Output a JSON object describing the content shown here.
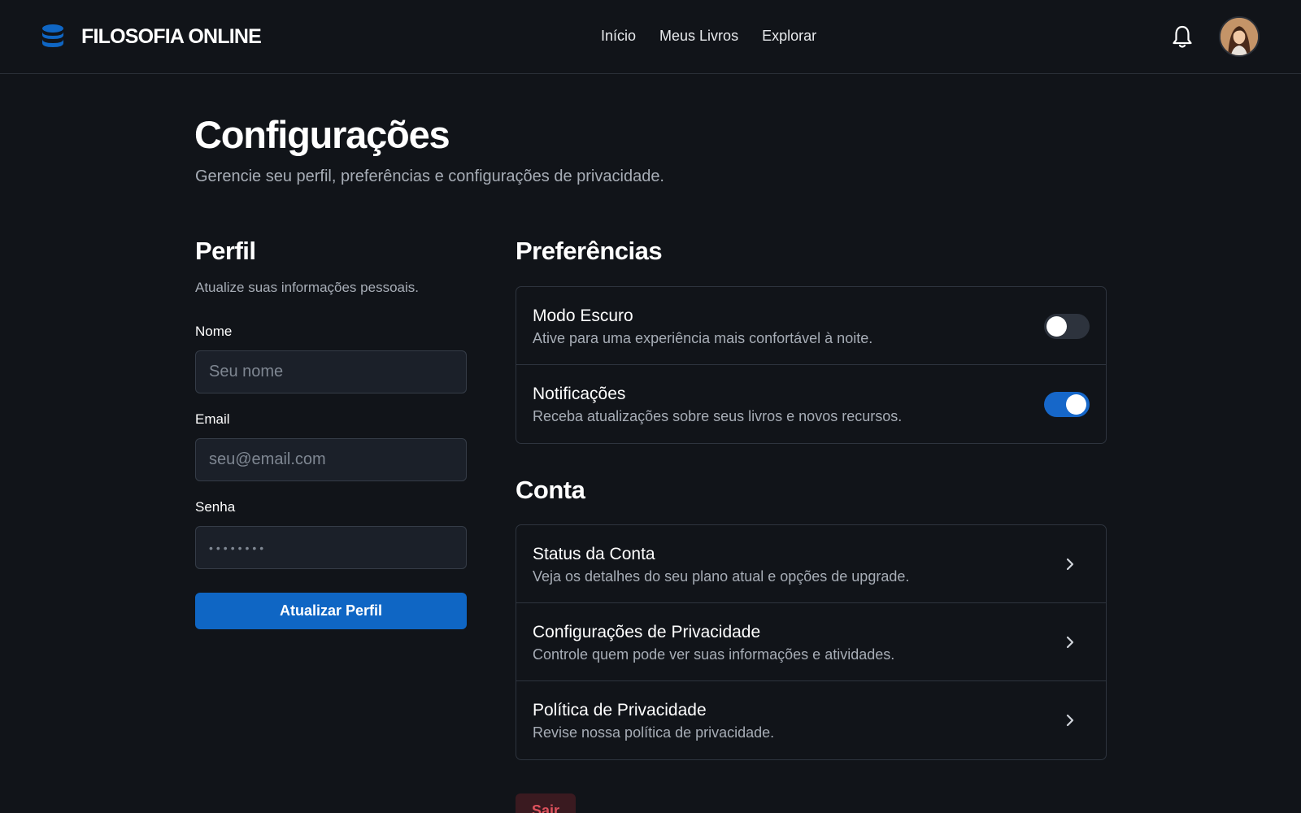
{
  "brand": {
    "name": "FILOSOFIA ONLINE",
    "accent": "#0f66c4"
  },
  "nav": {
    "items": [
      {
        "label": "Início"
      },
      {
        "label": "Meus Livros"
      },
      {
        "label": "Explorar"
      }
    ]
  },
  "header": {
    "notification_icon": "bell-icon",
    "avatar_icon": "user-avatar"
  },
  "page": {
    "title": "Configurações",
    "subtitle": "Gerencie seu perfil, preferências e configurações de privacidade."
  },
  "profile": {
    "title": "Perfil",
    "description": "Atualize suas informações pessoais.",
    "name_label": "Nome",
    "name_placeholder": "Seu nome",
    "email_label": "Email",
    "email_placeholder": "seu@email.com",
    "password_label": "Senha",
    "password_placeholder": "••••••••",
    "submit_label": "Atualizar Perfil"
  },
  "preferences": {
    "title": "Preferências",
    "items": [
      {
        "title": "Modo Escuro",
        "description": "Ative para uma experiência mais confortável à noite.",
        "enabled": false
      },
      {
        "title": "Notificações",
        "description": "Receba atualizações sobre seus livros e novos recursos.",
        "enabled": true
      }
    ]
  },
  "account": {
    "title": "Conta",
    "items": [
      {
        "title": "Status da Conta",
        "description": "Veja os detalhes do seu plano atual e opções de upgrade."
      },
      {
        "title": "Configurações de Privacidade",
        "description": "Controle quem pode ver suas informações e atividades."
      },
      {
        "title": "Política de Privacidade",
        "description": "Revise nossa política de privacidade."
      }
    ],
    "logout_label": "Sair"
  }
}
